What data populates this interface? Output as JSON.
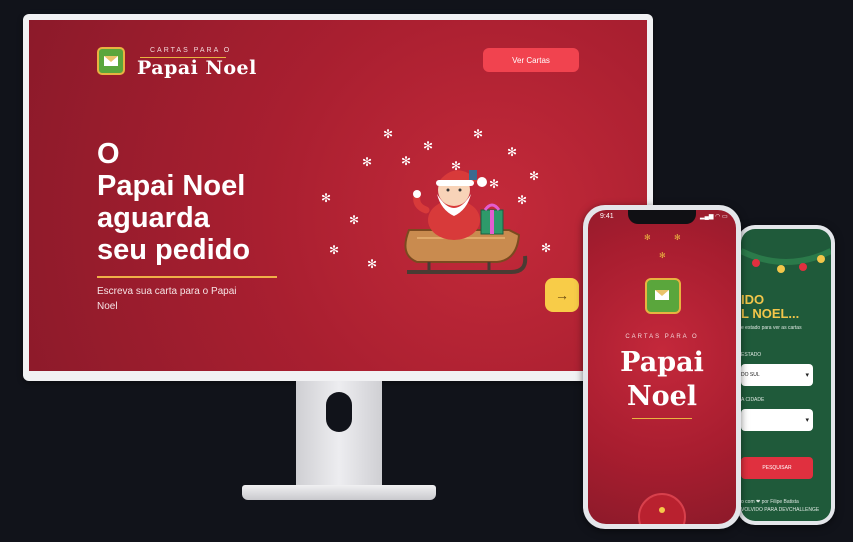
{
  "desktop": {
    "logo_small": "CARTAS PARA O",
    "logo_big": "Papai Noel",
    "nav_button": "Ver Cartas",
    "hero_lines": [
      "O",
      "Papai Noel",
      "aguarda",
      "seu pedido"
    ],
    "hero_sub": "Escreva sua carta para o Papai Noel",
    "next_arrow": "→"
  },
  "phone_main": {
    "time": "9:41",
    "status": "▂▄▆ ◠ ▭",
    "logo_small": "CARTAS PARA O",
    "logo_line1": "Papai",
    "logo_line2": "Noel"
  },
  "phone_secondary": {
    "title_line1": "IDO",
    "title_line2": "L NOEL...",
    "subtitle": "e estado para ver as cartas",
    "state_label": "ESTADO",
    "state_value": "DO SUL",
    "city_label": "A CIDADE",
    "city_value": "",
    "search_button": "PESQUISAR",
    "footer_line1": "o com ❤ por Filipe Batista",
    "footer_line2": "VOLVIDO PARA DEVCHALLENGE"
  },
  "colors": {
    "background": "#11131a",
    "hero_red": "#a91f30",
    "accent_red": "#f1434f",
    "gold": "#e9b440",
    "yellow_button": "#f8cc48",
    "green_screen": "#1f5a3a"
  },
  "icons": [
    "envelope-logo-icon",
    "arrow-right-icon",
    "snowflake-icon",
    "santa-sleigh-illustration",
    "chevron-down-icon"
  ]
}
